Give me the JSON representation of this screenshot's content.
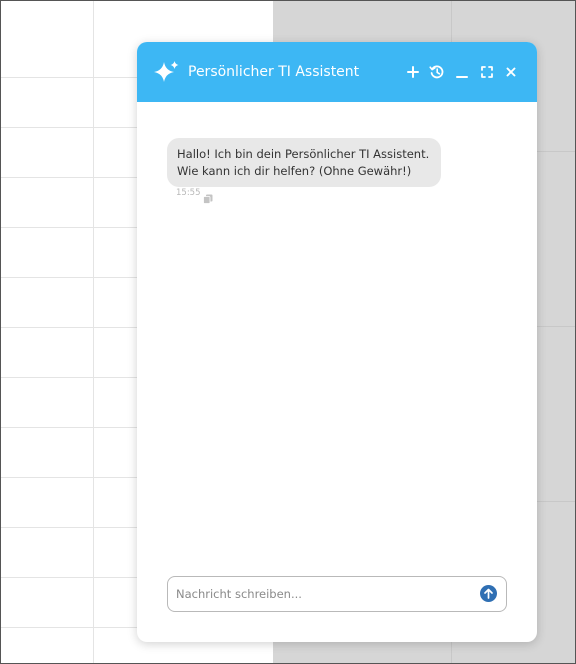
{
  "chat": {
    "title": "Persönlicher TI Assistent",
    "header_icons": [
      "sparkle-icon",
      "plus-icon",
      "history-icon",
      "minimize-icon",
      "expand-icon",
      "close-icon"
    ],
    "messages": [
      {
        "sender": "assistant",
        "text": "Hallo! Ich bin dein Persönlicher TI Assistent. Wie kann ich dir helfen? (Ohne Gewähr!)",
        "time": "15:55"
      }
    ],
    "input": {
      "value": "",
      "placeholder": "Nachricht schreiben..."
    }
  },
  "colors": {
    "header": "#3db7f4",
    "send_button": "#2f6fb3",
    "bubble": "#e8e8e8",
    "overlay": "#d6d6d6"
  }
}
